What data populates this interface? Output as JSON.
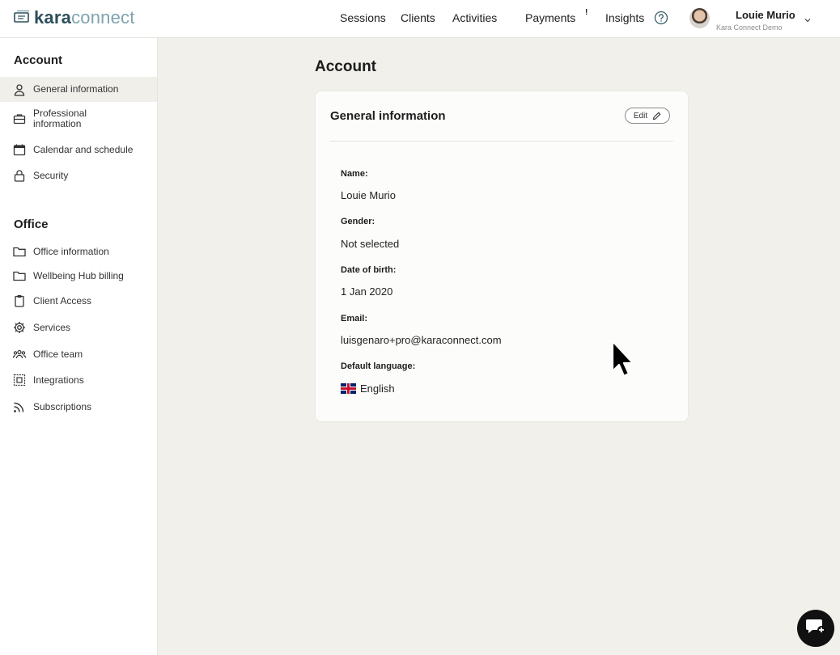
{
  "brand": {
    "part1": "kara",
    "part2": "connect"
  },
  "nav": {
    "sessions": "Sessions",
    "clients": "Clients",
    "activities": "Activities",
    "payments": "Payments",
    "payments_badge": "!",
    "insights": "Insights"
  },
  "user": {
    "name": "Louie Murio",
    "org": "Kara Connect Demo"
  },
  "sidebar": {
    "account_title": "Account",
    "account_items": [
      {
        "label": "General information",
        "icon": "user-icon"
      },
      {
        "label": "Professional information",
        "icon": "briefcase-icon"
      },
      {
        "label": "Calendar and schedule",
        "icon": "calendar-icon"
      },
      {
        "label": "Security",
        "icon": "lock-icon"
      }
    ],
    "office_title": "Office",
    "office_items": [
      {
        "label": "Office information",
        "icon": "folder-icon"
      },
      {
        "label": "Wellbeing Hub billing",
        "icon": "folder-icon"
      },
      {
        "label": "Client Access",
        "icon": "clipboard-icon"
      },
      {
        "label": "Services",
        "icon": "gear-icon"
      },
      {
        "label": "Office team",
        "icon": "team-icon"
      },
      {
        "label": "Integrations",
        "icon": "integrations-icon"
      },
      {
        "label": "Subscriptions",
        "icon": "rss-icon"
      }
    ]
  },
  "main": {
    "page_title": "Account",
    "card_title": "General information",
    "edit_label": "Edit",
    "fields": [
      {
        "label": "Name:",
        "value": "Louie Murio"
      },
      {
        "label": "Gender:",
        "value": "Not selected"
      },
      {
        "label": "Date of birth:",
        "value": "1 Jan 2020"
      },
      {
        "label": "Email:",
        "value": "luisgenaro+pro@karaconnect.com"
      },
      {
        "label": "Default language:",
        "value": "English"
      }
    ]
  },
  "colors": {
    "brand_dark": "#2d4f5c",
    "brand_light": "#7fa3ae",
    "background": "#f1f0eb",
    "active_item": "#f0efea"
  }
}
